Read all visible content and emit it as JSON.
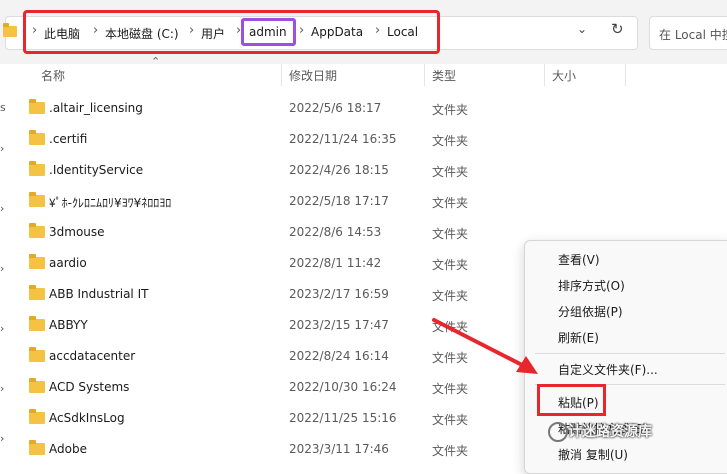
{
  "breadcrumb": [
    "此电脑",
    "本地磁盘 (C:)",
    "用户",
    "admin",
    "AppData",
    "Local"
  ],
  "search": {
    "placeholder": "在 Local 中搜"
  },
  "columns": {
    "name": "名称",
    "modified": "修改日期",
    "type": "类型",
    "size": "大小"
  },
  "nav_fragments": [
    "s"
  ],
  "files": [
    {
      "name": ".altair_licensing",
      "modified": "2022/5/6 18:17",
      "type": "文件夹"
    },
    {
      "name": ".certifi",
      "modified": "2022/11/24 16:35",
      "type": "文件夹"
    },
    {
      "name": ".IdentityService",
      "modified": "2022/4/26 18:15",
      "type": "文件夹"
    },
    {
      "name": "¥ﾟﾎ-ｸﾚﾛﾆﾑﾛﾘ¥ﾖﾜ¥ﾈﾛﾛﾖﾛ",
      "modified": "2022/5/18 17:17",
      "type": "文件夹"
    },
    {
      "name": "3dmouse",
      "modified": "2022/8/6 14:53",
      "type": "文件夹"
    },
    {
      "name": "aardio",
      "modified": "2022/8/1 11:42",
      "type": "文件夹"
    },
    {
      "name": "ABB Industrial IT",
      "modified": "2023/2/17 16:59",
      "type": "文件夹"
    },
    {
      "name": "ABBYY",
      "modified": "2023/2/15 17:47",
      "type": "文件夹"
    },
    {
      "name": "accdatacenter",
      "modified": "2022/8/24 16:14",
      "type": "文件夹"
    },
    {
      "name": "ACD Systems",
      "modified": "2022/10/30 16:24",
      "type": "文件夹"
    },
    {
      "name": "AcSdkInsLog",
      "modified": "2022/11/25 15:16",
      "type": "文件夹"
    },
    {
      "name": "Adobe",
      "modified": "2023/3/11 17:46",
      "type": "文件夹"
    }
  ],
  "context_menu": {
    "view": "查看(V)",
    "sort": "排序方式(O)",
    "group": "分组依据(P)",
    "refresh": "刷新(E)",
    "customize": "自定义文件夹(F)...",
    "paste": "粘贴(P)",
    "paste_shortcut": "粘贴快捷方式(S)",
    "undo": "撤消 复制(U)"
  },
  "watermark": "计迷路资源库",
  "colors": {
    "highlight_red": "#e8262d",
    "highlight_purple": "#9d4fe0",
    "folder": "#f5c343"
  }
}
